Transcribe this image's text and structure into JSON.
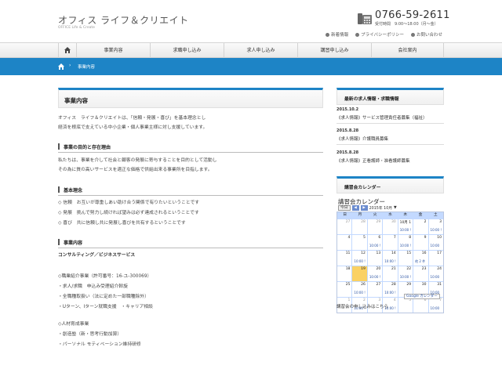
{
  "header": {
    "logo_ja": "オフィス ライフ＆クリエイト",
    "logo_en": "OFFICE Life & Create",
    "tel": "0766-59-2611",
    "hours": "受付時間　9:00～18:00（月～金）",
    "links": [
      "新着情報",
      "プライバシーポリシー",
      "お問い合わせ"
    ]
  },
  "nav": {
    "items": [
      "事業内容",
      "求職申し込み",
      "求人申し込み",
      "講習申し込み",
      "会社案内"
    ]
  },
  "breadcrumb": {
    "current": "事業内容"
  },
  "main": {
    "title": "事業内容",
    "intro": [
      "オフィス　ライフ＆クリエイトは、「信頼・発展・喜び」を基本理念とし",
      "経済を根底で支えている中小企業・個人事業主様に対し支援しています。"
    ],
    "purpose_heading": "事業の目的と存在理由",
    "purpose": [
      "私たちは、事業を介して社会と顧客の発展に寄与することを目的として活動し",
      "その為に質の高いサービスを適正な価格で供給出来る事業所を目指します。"
    ],
    "philosophy_heading": "基本理念",
    "philosophy": [
      "◇ 信頼　お互いが尊重しあい助け合う関係で有りたいということです",
      "◇ 発展　挑んで努力し続ければ望みは必ず達成されるということです",
      "◇ 喜び　共に信頼し共に発展し喜びを共有するということです"
    ],
    "business_heading": "事業内容",
    "business_sub": "コンサルティング／ビジネスサービス",
    "business_list1": [
      "◇職業紹介事業（許可番号：16-ユ-300069）",
      "・求人/求職　申込み受理紹介斡旋",
      "・全職種取扱い（法に定めた一部職種除外）",
      "・Uターン、Iターン就職支援　・キャリア相談"
    ],
    "business_list2": [
      "◇人材育成事業",
      "・創造塾（新・思考行動加算）",
      "・パーソナル モティベーション維持研修"
    ]
  },
  "sidebar": {
    "news_title": "最新の求人情報・求職情報",
    "news": [
      {
        "date": "2015.10.2",
        "title": "《求人情報》サービス管理責任者募集（福祉）"
      },
      {
        "date": "2015.8.28",
        "title": "《求人情報》介護職員募集"
      },
      {
        "date": "2015.8.28",
        "title": "《求人情報》正看護師・准看護師募集"
      }
    ],
    "calendar_box_title": "講習会カレンダー",
    "calendar": {
      "title": "講習会カレンダー",
      "today_button": "今日",
      "prev": "◀",
      "next": "▶",
      "month_label": "2015年 10月",
      "weekdays": [
        "日",
        "月",
        "火",
        "水",
        "木",
        "金",
        "土"
      ],
      "weeks": [
        [
          {
            "d": "27",
            "o": true
          },
          {
            "d": "28",
            "o": true
          },
          {
            "d": "29",
            "o": true
          },
          {
            "d": "30",
            "o": true
          },
          {
            "d": "10月 1",
            "e": "10:00 !"
          },
          {
            "d": "2"
          },
          {
            "d": "3",
            "e": "10:00 !"
          }
        ],
        [
          {
            "d": "4"
          },
          {
            "d": "5"
          },
          {
            "d": "6",
            "e": "10:00 !"
          },
          {
            "d": "7"
          },
          {
            "d": "8",
            "e": "10:00 !"
          },
          {
            "d": "9"
          },
          {
            "d": "10",
            "e": "10:00"
          }
        ],
        [
          {
            "d": "11"
          },
          {
            "d": "12",
            "e": "10:00 !"
          },
          {
            "d": "13"
          },
          {
            "d": "14",
            "e": "10:00 !"
          },
          {
            "d": "15"
          },
          {
            "d": "16",
            "e": "他 2 件"
          },
          {
            "d": "17"
          }
        ],
        [
          {
            "d": "18"
          },
          {
            "d": "19",
            "t": true
          },
          {
            "d": "20",
            "e": "10:00 !"
          },
          {
            "d": "21"
          },
          {
            "d": "22",
            "e": "10:00 !"
          },
          {
            "d": "23"
          },
          {
            "d": "24",
            "e": "10:00"
          }
        ],
        [
          {
            "d": "25"
          },
          {
            "d": "26",
            "e": "10:00 !"
          },
          {
            "d": "27"
          },
          {
            "d": "28",
            "e": "10:00 !"
          },
          {
            "d": "29"
          },
          {
            "d": "30"
          },
          {
            "d": "31",
            "e": "10:00"
          }
        ],
        [
          {
            "d": "1",
            "o": true
          },
          {
            "d": "2",
            "o": true,
            "e": "10:00 !"
          },
          {
            "d": "3",
            "o": true
          },
          {
            "d": "4",
            "o": true,
            "e": "10:00 !"
          },
          {
            "d": "5",
            "o": true
          },
          {
            "d": "6",
            "o": true
          },
          {
            "d": "7",
            "o": true,
            "e": "10:00"
          }
        ]
      ],
      "google_badge": "Google カレンダー",
      "apply_link": "講習会の申し込みはこちら"
    }
  }
}
